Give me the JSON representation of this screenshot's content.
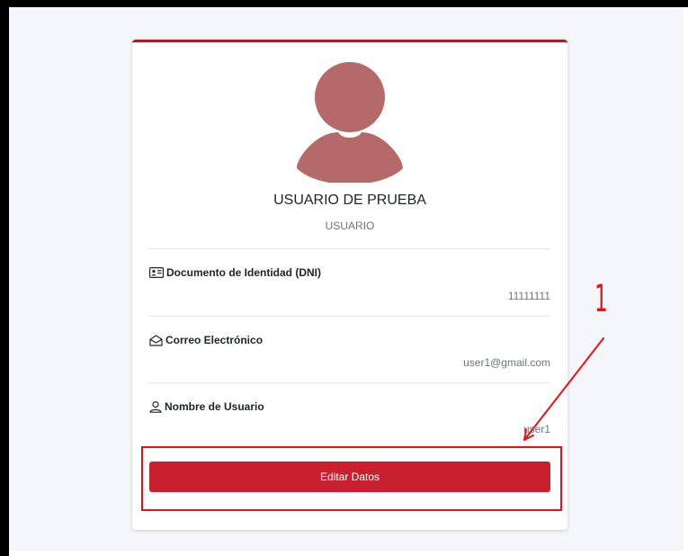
{
  "profile": {
    "name": "USUARIO DE PRUEBA",
    "role": "USUARIO"
  },
  "fields": [
    {
      "label": "Documento de Identidad (DNI)",
      "value": "11111111",
      "icon": "id-card-icon"
    },
    {
      "label": "Correo Electrónico",
      "value": "user1@gmail.com",
      "icon": "envelope-open-icon"
    },
    {
      "label": "Nombre de Usuario",
      "value": "user1",
      "icon": "person-icon"
    }
  ],
  "actions": {
    "edit_label": "Editar Datos"
  },
  "annotation": {
    "step_number": "1",
    "color": "#e3131b"
  },
  "colors": {
    "accent": "#c8202f",
    "avatar": "#b56a6a",
    "card_border_top": "#a91e22"
  }
}
